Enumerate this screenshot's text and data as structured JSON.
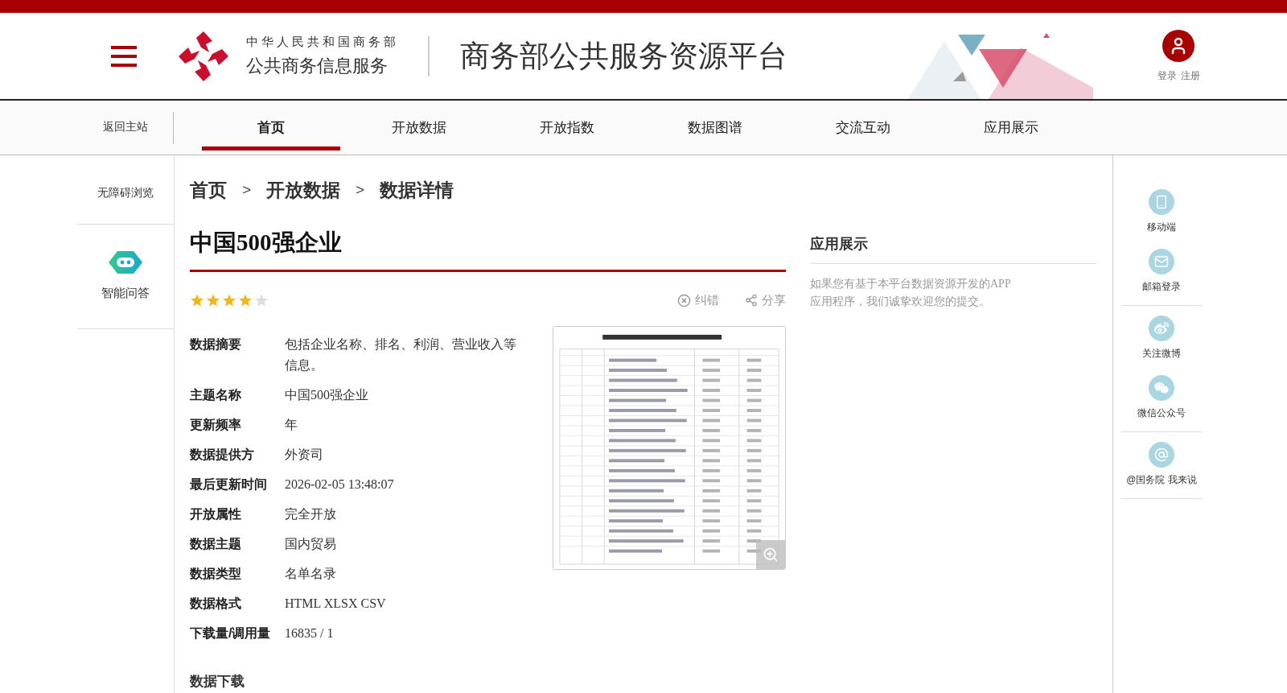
{
  "header": {
    "org_line1": "中华人民共和国商务部",
    "org_line2": "公共商务信息服务",
    "platform_title": "商务部公共服务资源平台",
    "auth_links": [
      "登录",
      "注册"
    ]
  },
  "nav": {
    "back_link": "返回主站",
    "tabs": [
      {
        "label": "首页",
        "selected": true
      },
      {
        "label": "开放数据",
        "selected": false
      },
      {
        "label": "开放指数",
        "selected": false
      },
      {
        "label": "数据图谱",
        "selected": false
      },
      {
        "label": "交流互动",
        "selected": false
      },
      {
        "label": "应用展示",
        "selected": false
      }
    ]
  },
  "left_sidebar": {
    "accessibility": "无障碍浏览",
    "assistant": "智能问答"
  },
  "breadcrumb": [
    {
      "kind": "link",
      "text": "首页"
    },
    {
      "kind": "separator",
      "text": ">"
    },
    {
      "kind": "link",
      "text": "开放数据"
    },
    {
      "kind": "separator",
      "text": ">"
    },
    {
      "kind": "current",
      "text": "数据详情"
    }
  ],
  "dataset": {
    "title": "中国500强企业",
    "stars": 4,
    "actions": [
      {
        "kind": "report",
        "label": "纠错"
      },
      {
        "kind": "share",
        "label": "分享"
      }
    ],
    "fields": [
      {
        "label": "数据摘要",
        "value": "包括企业名称、排名、利润、营业收入等信息。"
      },
      {
        "label": "主题名称",
        "value": "中国500强企业"
      },
      {
        "label": "更新频率",
        "value": "年"
      },
      {
        "label": "数据提供方",
        "value": "外资司"
      },
      {
        "label": "最后更新时间",
        "value": "2026-02-05 13:48:07"
      },
      {
        "label": "开放属性",
        "value": "完全开放"
      },
      {
        "label": "数据主题",
        "value": "国内贸易"
      },
      {
        "label": "数据类型",
        "value": "名单名录"
      },
      {
        "label": "数据格式",
        "value": "HTML XLSX CSV"
      },
      {
        "label": "下载量/调用量",
        "value": "16835 / 1"
      }
    ],
    "section_heading": "数据下载"
  },
  "apps_panel": {
    "title": "应用展示",
    "description": "如果您有基于本平台数据资源开发的APP应用程序，我们诚挚欢迎您的提交。"
  },
  "right_sidebar": [
    [
      {
        "kind": "mobile",
        "label": "移动端"
      },
      {
        "kind": "mail",
        "label": "邮箱登录"
      }
    ],
    [
      {
        "kind": "weibo",
        "label": "关注微博"
      },
      {
        "kind": "wechat",
        "label": "微信公众号"
      }
    ],
    [
      {
        "kind": "at",
        "label": "@国务院 我来说"
      }
    ]
  ]
}
